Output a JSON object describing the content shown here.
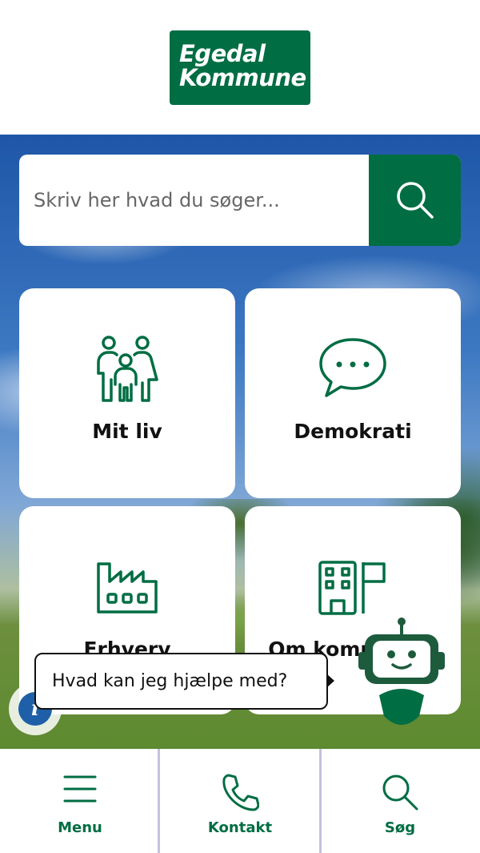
{
  "logo": {
    "line1": "Egedal",
    "line2": "Kommune"
  },
  "search": {
    "placeholder": "Skriv her hvad du søger..."
  },
  "tiles": [
    {
      "label": "Mit liv",
      "icon": "family-icon"
    },
    {
      "label": "Demokrati",
      "icon": "speech-bubble-icon"
    },
    {
      "label": "Erhverv",
      "icon": "factory-icon"
    },
    {
      "label": "Om kommunen",
      "icon": "city-hall-icon"
    }
  ],
  "chatbot": {
    "prompt": "Hvad kan jeg hjælpe med?"
  },
  "info": {
    "glyph": "i"
  },
  "nav": [
    {
      "label": "Menu",
      "icon": "hamburger-menu-icon"
    },
    {
      "label": "Kontakt",
      "icon": "phone-icon"
    },
    {
      "label": "Søg",
      "icon": "search-icon"
    }
  ],
  "colors": {
    "brand": "#006d43",
    "info": "#1e5fa8"
  }
}
